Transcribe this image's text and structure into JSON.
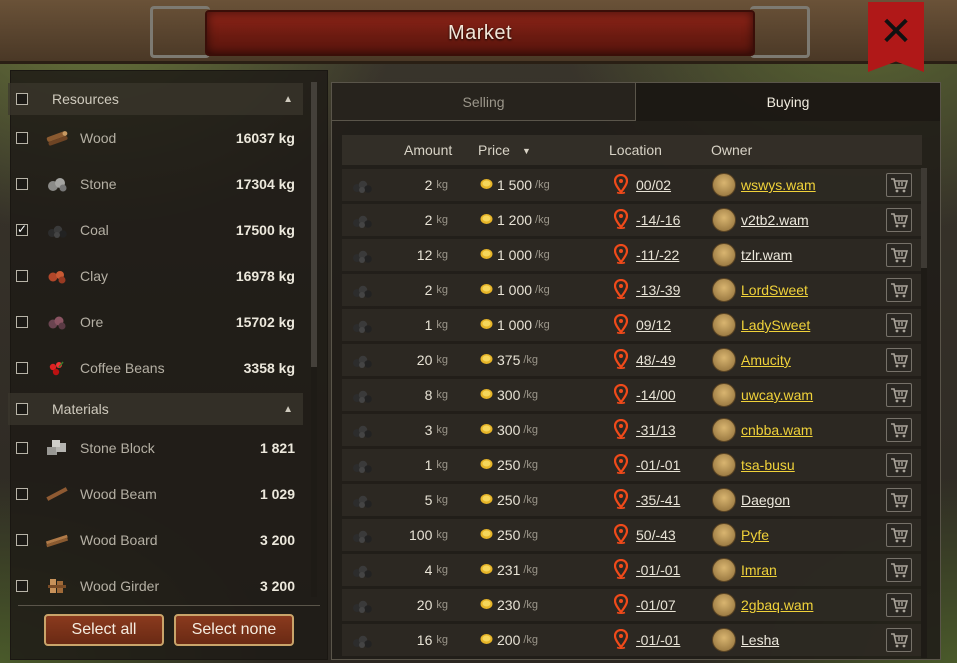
{
  "window": {
    "title": "Market",
    "close_glyph": "✕"
  },
  "colors": {
    "owner_link_yellow": "#f0d23a",
    "owner_link_white": "#ece8dc",
    "banner_red": "#8e2418",
    "button_brown": "#8a3a1e"
  },
  "filters": {
    "resources_header": "Resources",
    "materials_header": "Materials",
    "resources": [
      {
        "label": "Wood",
        "qty": "16037 kg",
        "checked": false,
        "icon": "wood-icon"
      },
      {
        "label": "Stone",
        "qty": "17304 kg",
        "checked": false,
        "icon": "stone-icon"
      },
      {
        "label": "Coal",
        "qty": "17500 kg",
        "checked": true,
        "icon": "coal-icon"
      },
      {
        "label": "Clay",
        "qty": "16978 kg",
        "checked": false,
        "icon": "clay-icon"
      },
      {
        "label": "Ore",
        "qty": "15702 kg",
        "checked": false,
        "icon": "ore-icon"
      },
      {
        "label": "Coffee Beans",
        "qty": "3358 kg",
        "checked": false,
        "icon": "coffee-beans-icon"
      }
    ],
    "materials": [
      {
        "label": "Stone Block",
        "qty": "1 821",
        "checked": false,
        "icon": "stone-block-icon"
      },
      {
        "label": "Wood Beam",
        "qty": "1 029",
        "checked": false,
        "icon": "wood-beam-icon"
      },
      {
        "label": "Wood Board",
        "qty": "3 200",
        "checked": false,
        "icon": "wood-board-icon"
      },
      {
        "label": "Wood Girder",
        "qty": "3 200",
        "checked": false,
        "icon": "wood-girder-icon"
      }
    ],
    "select_all": "Select all",
    "select_none": "Select none"
  },
  "tabs": {
    "selling": "Selling",
    "buying": "Buying",
    "active": "buying"
  },
  "table": {
    "headers": {
      "amount": "Amount",
      "price": "Price",
      "location": "Location",
      "owner": "Owner",
      "sort_glyph": "▼"
    },
    "unit_kg": "kg",
    "unit_per_kg": "/kg",
    "rows": [
      {
        "amount": "2",
        "price": "1 500",
        "location": "00/02",
        "owner": "wswys.wam",
        "owner_color": "yellow"
      },
      {
        "amount": "2",
        "price": "1 200",
        "location": "-14/-16",
        "owner": "v2tb2.wam",
        "owner_color": "white"
      },
      {
        "amount": "12",
        "price": "1 000",
        "location": "-11/-22",
        "owner": "tzlr.wam",
        "owner_color": "white"
      },
      {
        "amount": "2",
        "price": "1 000",
        "location": "-13/-39",
        "owner": "LordSweet",
        "owner_color": "yellow"
      },
      {
        "amount": "1",
        "price": "1 000",
        "location": "09/12",
        "owner": "LadySweet",
        "owner_color": "yellow"
      },
      {
        "amount": "20",
        "price": "375",
        "location": "48/-49",
        "owner": "Amucity",
        "owner_color": "yellow"
      },
      {
        "amount": "8",
        "price": "300",
        "location": "-14/00",
        "owner": "uwcay.wam",
        "owner_color": "yellow"
      },
      {
        "amount": "3",
        "price": "300",
        "location": "-31/13",
        "owner": "cnbba.wam",
        "owner_color": "yellow"
      },
      {
        "amount": "1",
        "price": "250",
        "location": "-01/-01",
        "owner": "tsa-busu",
        "owner_color": "yellow"
      },
      {
        "amount": "5",
        "price": "250",
        "location": "-35/-41",
        "owner": "Daegon",
        "owner_color": "white"
      },
      {
        "amount": "100",
        "price": "250",
        "location": "50/-43",
        "owner": "Pyfe",
        "owner_color": "yellow"
      },
      {
        "amount": "4",
        "price": "231",
        "location": "-01/-01",
        "owner": "Imran",
        "owner_color": "yellow"
      },
      {
        "amount": "20",
        "price": "230",
        "location": "-01/07",
        "owner": "2gbaq.wam",
        "owner_color": "yellow"
      },
      {
        "amount": "16",
        "price": "200",
        "location": "-01/-01",
        "owner": "Lesha",
        "owner_color": "white"
      }
    ]
  }
}
